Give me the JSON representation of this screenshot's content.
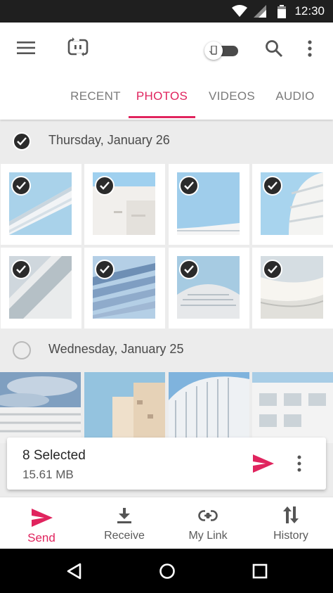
{
  "status_bar": {
    "time": "12:30",
    "icons": [
      "wifi-icon",
      "signal-icon",
      "battery-icon"
    ]
  },
  "app_bar": {
    "icons": [
      "menu-icon",
      "app-logo-icon",
      "device-toggle",
      "search-icon",
      "more-vert-icon"
    ]
  },
  "tabs": [
    {
      "label": "RECENT",
      "active": false
    },
    {
      "label": "PHOTOS",
      "active": true
    },
    {
      "label": "VIDEOS",
      "active": false
    },
    {
      "label": "AUDIO",
      "active": false
    }
  ],
  "groups": [
    {
      "date": "Thursday, January 26",
      "selected": true,
      "photos_selected": [
        true,
        true,
        true,
        true,
        true,
        true,
        true,
        true
      ]
    },
    {
      "date": "Wednesday, January 25",
      "selected": false
    }
  ],
  "selection": {
    "count_label": "8 Selected",
    "size_label": "15.61 MB"
  },
  "bottom_nav": [
    {
      "label": "Send",
      "icon": "send-icon",
      "active": true
    },
    {
      "label": "Receive",
      "icon": "download-icon",
      "active": false
    },
    {
      "label": "My Link",
      "icon": "link-icon",
      "active": false
    },
    {
      "label": "History",
      "icon": "swap-vert-icon",
      "active": false
    }
  ],
  "colors": {
    "accent": "#e0245e",
    "header_bg": "#ffffff",
    "page_bg": "#ececec",
    "check_fill": "#2b2b2b"
  }
}
